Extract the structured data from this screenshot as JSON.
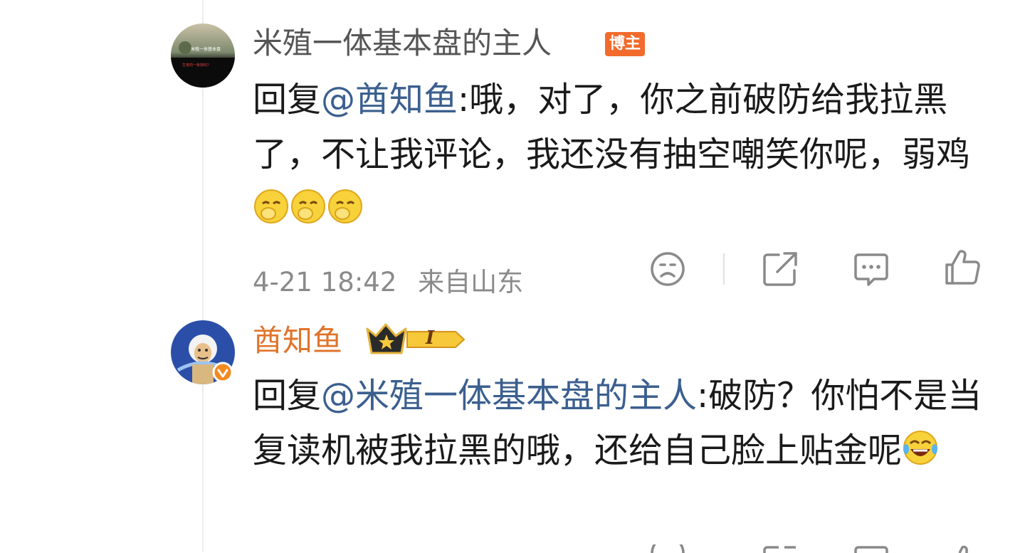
{
  "comments": [
    {
      "user": "米殖一体基本盘的主人",
      "badge": "博主",
      "reply_prefix": "回复",
      "mention": "@酋知鱼",
      "text": ":哦，对了，你之前破防给我拉黑了，不让我评论，我还没有抽空嘲笑你呢，弱鸡",
      "emojis": [
        "shy-emoji",
        "shy-emoji",
        "shy-emoji"
      ],
      "time": "4-21 18:42",
      "location": "来自山东",
      "avatar_caption_1": "米殖一体基本盘",
      "avatar_caption_2": "生育的一条狗吗？"
    },
    {
      "user": "酋知鱼",
      "level": "I",
      "reply_prefix": "回复",
      "mention": "@米殖一体基本盘的主人",
      "text": ":破防？你怕不是当复读机被我拉黑的哦，还给自己脸上贴金呢",
      "emojis": [
        "laugh-cry-emoji"
      ]
    }
  ],
  "colors": {
    "name_orange": "#e0742b",
    "mention": "#3b5f8f",
    "meta": "#8a8a8a",
    "badge": "#f26b2c"
  },
  "actions": [
    "dislike-icon",
    "share-icon",
    "comment-icon",
    "like-icon"
  ]
}
